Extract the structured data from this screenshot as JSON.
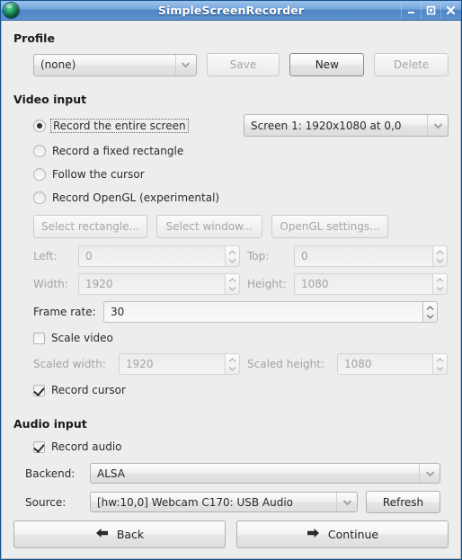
{
  "window": {
    "title": "SimpleScreenRecorder",
    "icon": "app-globe-icon",
    "controls": {
      "minimize": "minimize-icon",
      "maximize": "maximize-icon",
      "close": "close-icon"
    }
  },
  "profile": {
    "heading": "Profile",
    "combo_value": "(none)",
    "save_label": "Save",
    "new_label": "New",
    "delete_label": "Delete"
  },
  "video": {
    "heading": "Video input",
    "options": [
      {
        "label": "Record the entire screen",
        "checked": true
      },
      {
        "label": "Record a fixed rectangle",
        "checked": false
      },
      {
        "label": "Follow the cursor",
        "checked": false
      },
      {
        "label": "Record OpenGL (experimental)",
        "checked": false
      }
    ],
    "screen_combo_value": "Screen 1: 1920x1080 at 0,0",
    "select_rectangle_label": "Select rectangle...",
    "select_window_label": "Select window...",
    "opengl_settings_label": "OpenGL settings...",
    "left_label": "Left:",
    "left_value": "0",
    "top_label": "Top:",
    "top_value": "0",
    "width_label": "Width:",
    "width_value": "1920",
    "height_label": "Height:",
    "height_value": "1080",
    "frame_rate_label": "Frame rate:",
    "frame_rate_value": "30",
    "scale_video_label": "Scale video",
    "scale_video_checked": false,
    "scaled_width_label": "Scaled width:",
    "scaled_width_value": "1920",
    "scaled_height_label": "Scaled height:",
    "scaled_height_value": "1080",
    "record_cursor_label": "Record cursor",
    "record_cursor_checked": true
  },
  "audio": {
    "heading": "Audio input",
    "record_audio_label": "Record audio",
    "record_audio_checked": true,
    "backend_label": "Backend:",
    "backend_value": "ALSA",
    "source_label": "Source:",
    "source_value": "[hw:10,0] Webcam C170: USB Audio",
    "refresh_label": "Refresh"
  },
  "footer": {
    "back_label": "Back",
    "continue_label": "Continue"
  },
  "colors": {
    "titlebar_blue": "#4e85c5",
    "window_border": "#16548f",
    "client_bg": "#ededed"
  }
}
